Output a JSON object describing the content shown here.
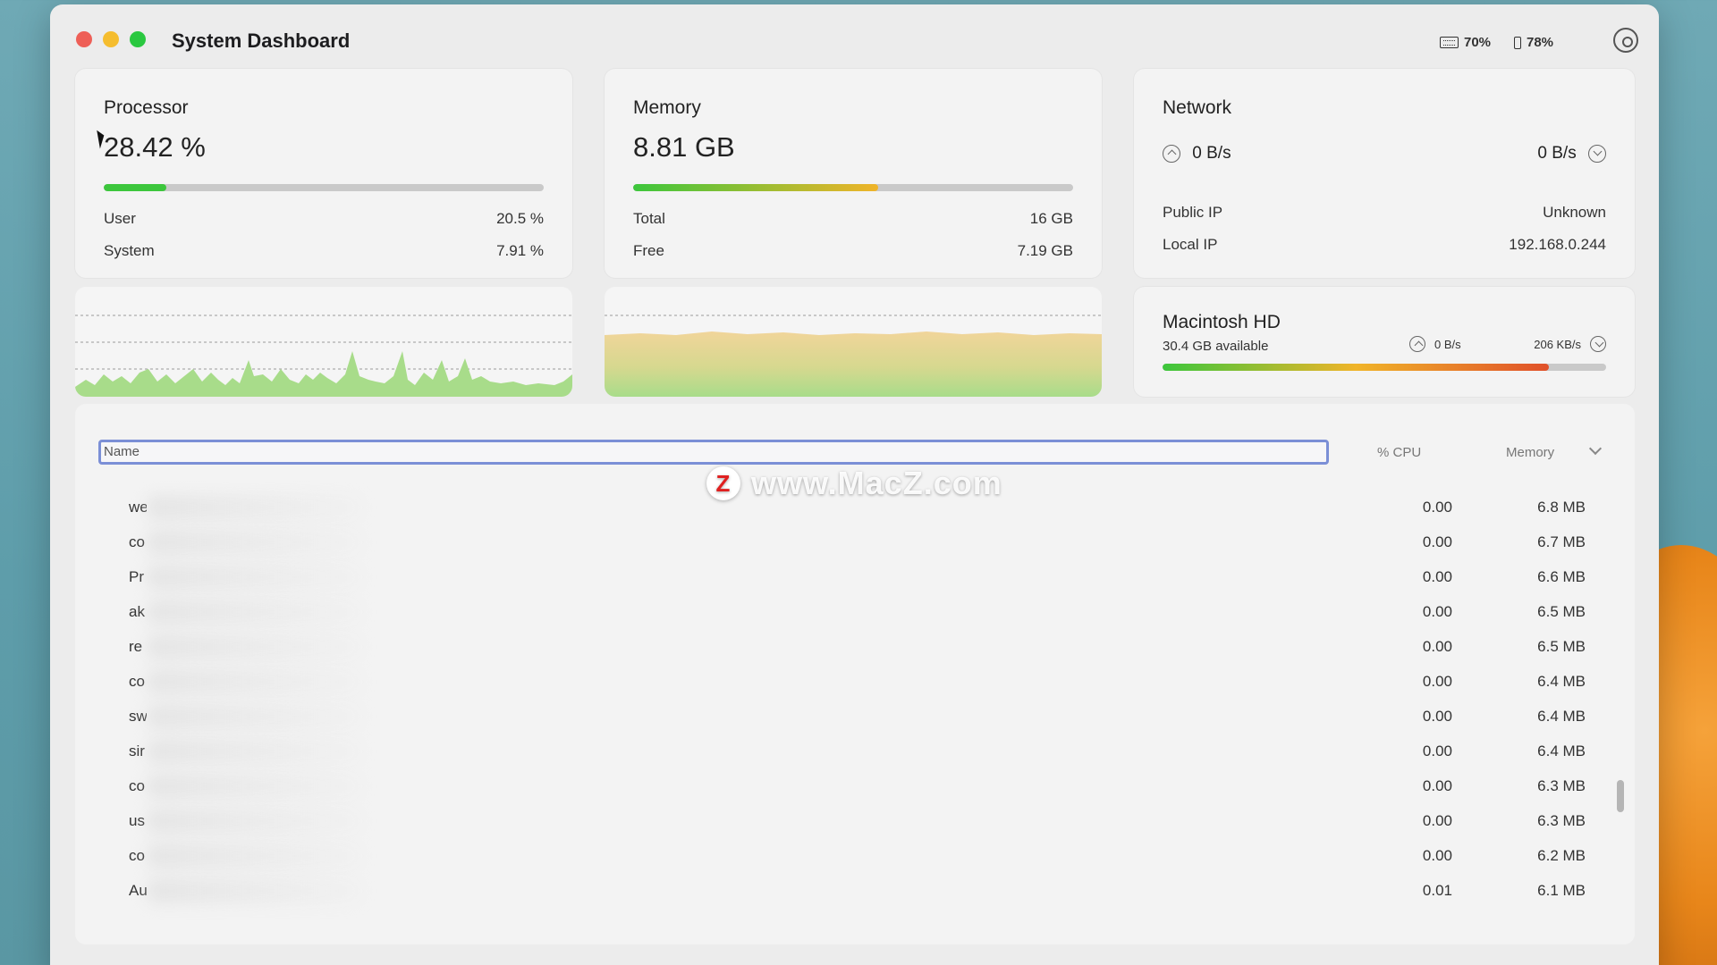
{
  "window": {
    "title": "System Dashboard"
  },
  "status": {
    "keyboard": "70%",
    "battery": "78%"
  },
  "processor": {
    "title": "Processor",
    "usage": "28.42 %",
    "usage_fraction": 0.1425,
    "user_label": "User",
    "user_value": "20.5 %",
    "system_label": "System",
    "system_value": "7.91 %"
  },
  "memory": {
    "title": "Memory",
    "used": "8.81 GB",
    "usage_fraction": 0.557,
    "total_label": "Total",
    "total_value": "16 GB",
    "free_label": "Free",
    "free_value": "7.19 GB"
  },
  "network": {
    "title": "Network",
    "upload": "0 B/s",
    "download": "0 B/s",
    "public_ip_label": "Public IP",
    "public_ip_value": "Unknown",
    "local_ip_label": "Local IP",
    "local_ip_value": "192.168.0.244"
  },
  "disk": {
    "title": "Macintosh HD",
    "available": "30.4 GB available",
    "read": "0 B/s",
    "write": "206 KB/s",
    "usage_fraction": 0.871
  },
  "table": {
    "col_name": "Name",
    "col_cpu": "% CPU",
    "col_memory": "Memory",
    "rows": [
      {
        "name": "we",
        "cpu": "0.00",
        "mem": "6.8 MB"
      },
      {
        "name": "co",
        "cpu": "0.00",
        "mem": "6.7 MB"
      },
      {
        "name": "Pr",
        "cpu": "0.00",
        "mem": "6.6 MB"
      },
      {
        "name": "ak",
        "cpu": "0.00",
        "mem": "6.5 MB"
      },
      {
        "name": "re",
        "cpu": "0.00",
        "mem": "6.5 MB"
      },
      {
        "name": "co",
        "cpu": "0.00",
        "mem": "6.4 MB"
      },
      {
        "name": "sw",
        "cpu": "0.00",
        "mem": "6.4 MB"
      },
      {
        "name": "sir",
        "cpu": "0.00",
        "mem": "6.4 MB"
      },
      {
        "name": "co",
        "cpu": "0.00",
        "mem": "6.3 MB"
      },
      {
        "name": "us",
        "cpu": "0.00",
        "mem": "6.3 MB"
      },
      {
        "name": "co",
        "cpu": "0.00",
        "mem": "6.2 MB"
      },
      {
        "name": "Au",
        "cpu": "0.01",
        "mem": "6.1 MB"
      }
    ]
  },
  "watermark": {
    "logo": "Z",
    "text": "www.MacZ.com"
  },
  "colors": {
    "cpu_bar": "#3cc63c",
    "mem_bar_gradient": [
      "#3cc63c",
      "#f0b429"
    ],
    "disk_bar_gradient": [
      "#3cc63c",
      "#f0b429",
      "#e0502a"
    ],
    "graph_green": "#a8dc8a",
    "graph_orange": "#f1d59a",
    "selection_border": "#7b8fd6"
  },
  "icons": [
    "keyboard-icon",
    "battery-icon",
    "settings-gear-icon",
    "upload-arrow-icon",
    "download-arrow-icon",
    "dropdown-chevron-icon"
  ]
}
